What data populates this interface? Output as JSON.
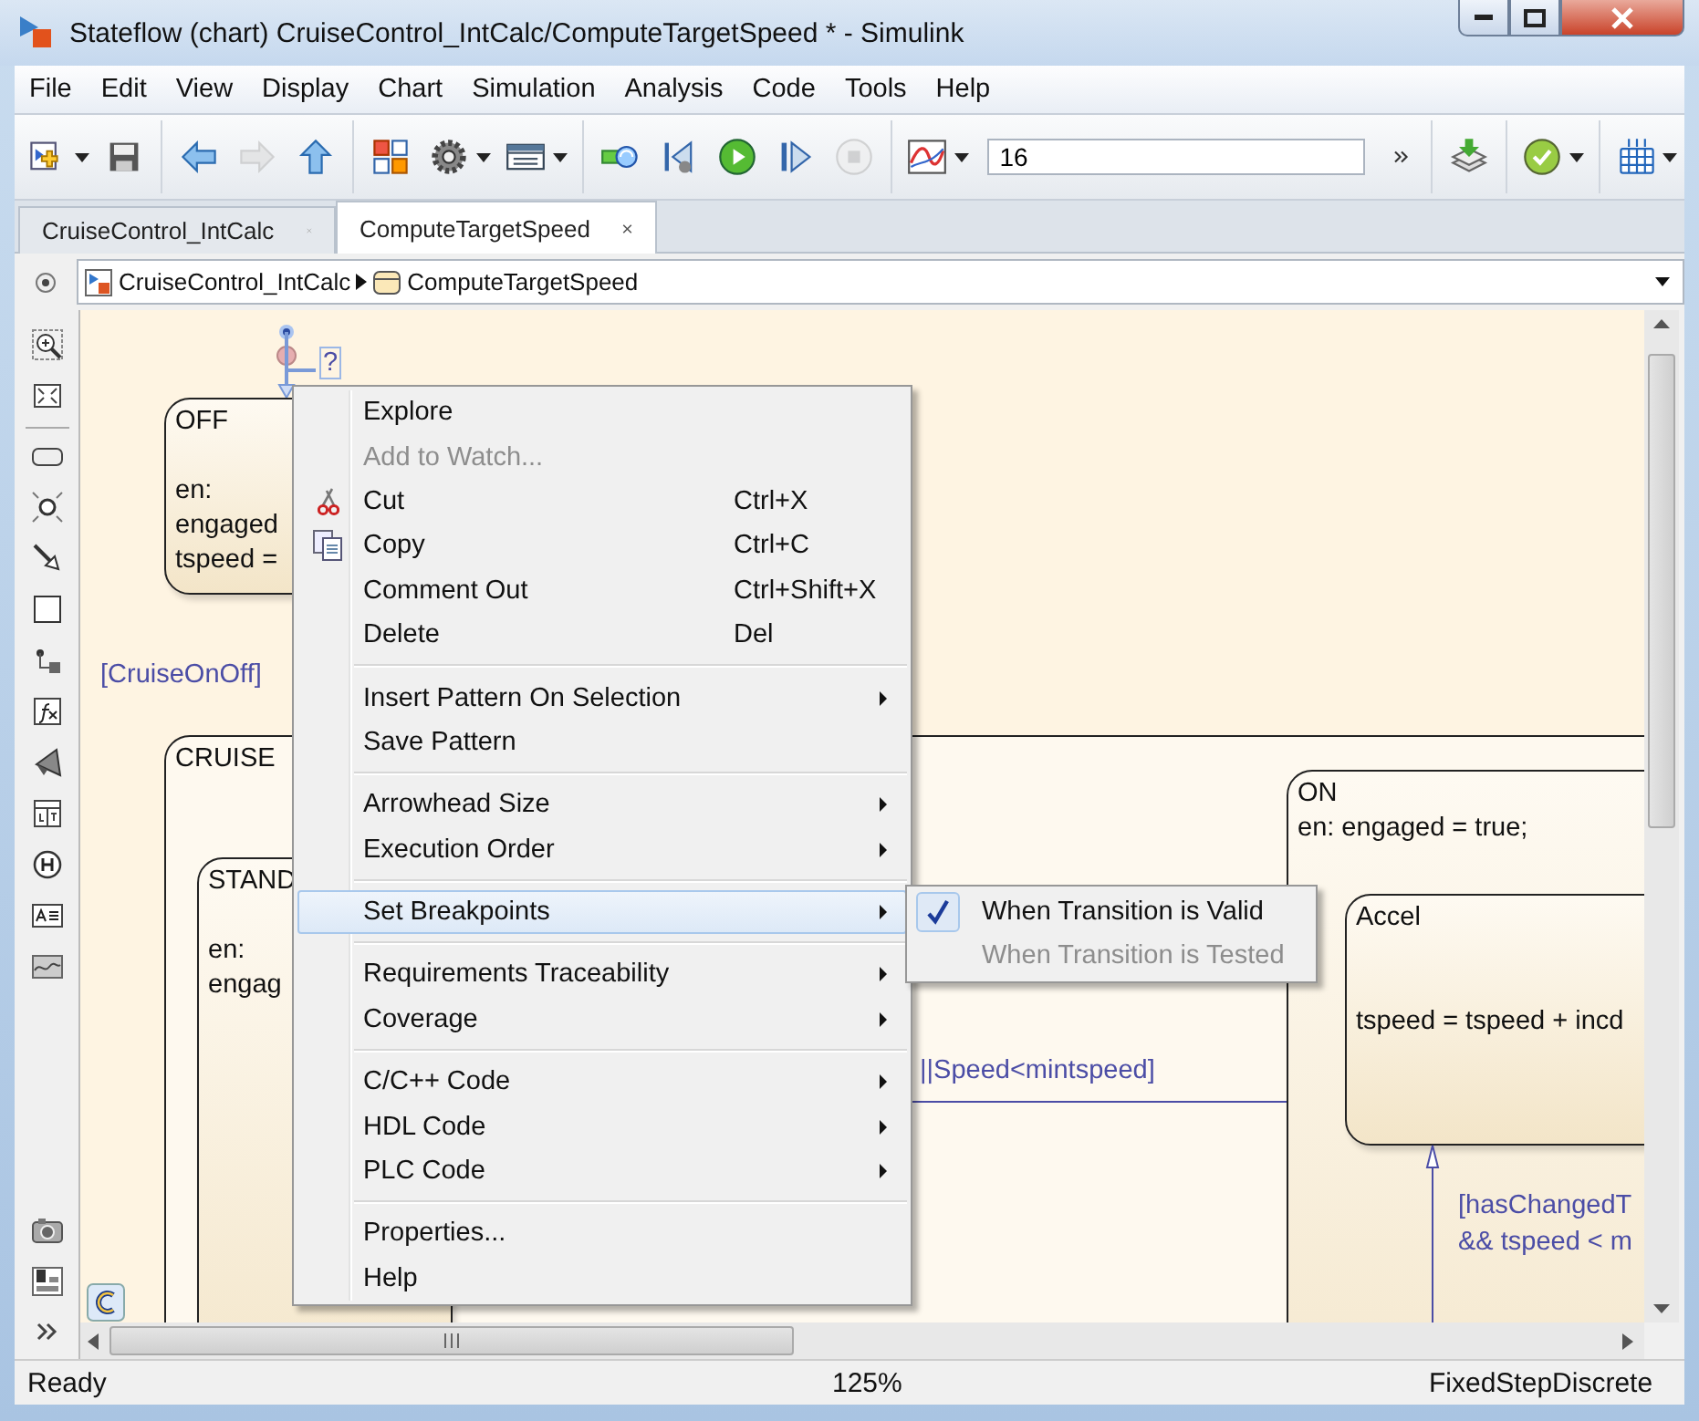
{
  "window": {
    "title": "Stateflow (chart) CruiseControl_IntCalc/ComputeTargetSpeed * - Simulink"
  },
  "menu_bar": [
    "File",
    "Edit",
    "View",
    "Display",
    "Chart",
    "Simulation",
    "Analysis",
    "Code",
    "Tools",
    "Help"
  ],
  "toolbar": {
    "buttons": [
      {
        "kind": "new-model",
        "disabled": false
      },
      {
        "kind": "save",
        "disabled": false
      },
      {
        "kind": "back",
        "disabled": false
      },
      {
        "kind": "forward",
        "disabled": true
      },
      {
        "kind": "up",
        "disabled": false
      },
      {
        "kind": "library",
        "disabled": false
      },
      {
        "kind": "gear",
        "disabled": false
      },
      {
        "kind": "config",
        "disabled": false
      },
      {
        "kind": "record",
        "disabled": false
      },
      {
        "kind": "step-back",
        "disabled": false
      },
      {
        "kind": "run",
        "disabled": false
      },
      {
        "kind": "step-forward",
        "disabled": false
      },
      {
        "kind": "stop",
        "disabled": true
      },
      {
        "kind": "scope",
        "disabled": false
      }
    ],
    "stop_time": "16",
    "right_buttons": [
      {
        "kind": "more",
        "disabled": false
      },
      {
        "kind": "layers",
        "disabled": false
      },
      {
        "kind": "check",
        "disabled": false
      },
      {
        "kind": "grid",
        "disabled": false
      }
    ]
  },
  "tabs": [
    {
      "label": "CruiseControl_IntCalc",
      "selected": false
    },
    {
      "label": "ComputeTargetSpeed",
      "selected": true
    }
  ],
  "breadcrumb": [
    {
      "kind": "model",
      "label": "CruiseControl_IntCalc"
    },
    {
      "kind": "chart",
      "label": "ComputeTargetSpeed"
    }
  ],
  "chart": {
    "states": [
      {
        "name": "OFF",
        "actions": [
          "en:",
          "engaged",
          "tspeed ="
        ]
      },
      {
        "name": "CRUISE"
      },
      {
        "name": "STAND",
        "actions": [
          "en:",
          "engag"
        ]
      },
      {
        "name": "ON",
        "actions": [
          "en: engaged = true;"
        ]
      },
      {
        "name": "Accel",
        "actions": [
          "tspeed = tspeed + incd"
        ]
      }
    ],
    "transition_labels": [
      [
        "[CruiseOnOff]"
      ],
      [
        "||Speed<mintspeed]"
      ],
      [
        "[hasChangedT",
        "&& tspeed < m"
      ]
    ],
    "pending_label": "?"
  },
  "context_menu": [
    [
      {
        "label": "Explore",
        "disabled": false,
        "selected": false,
        "submenu": false
      },
      {
        "label": "Add to Watch...",
        "disabled": true,
        "selected": false,
        "submenu": false
      },
      {
        "label": "Cut",
        "shortcut": "Ctrl+X",
        "disabled": false,
        "selected": false,
        "submenu": false
      },
      {
        "label": "Copy",
        "shortcut": "Ctrl+C",
        "disabled": false,
        "selected": false,
        "submenu": false
      },
      {
        "label": "Comment Out",
        "shortcut": "Ctrl+Shift+X",
        "disabled": false,
        "selected": false,
        "submenu": false
      },
      {
        "label": "Delete",
        "shortcut": "Del",
        "disabled": false,
        "selected": false,
        "submenu": false
      }
    ],
    [
      {
        "label": "Insert Pattern On Selection",
        "disabled": false,
        "selected": false,
        "submenu": true
      },
      {
        "label": "Save Pattern",
        "disabled": false,
        "selected": false,
        "submenu": false
      }
    ],
    [
      {
        "label": "Arrowhead Size",
        "disabled": false,
        "selected": false,
        "submenu": true
      },
      {
        "label": "Execution Order",
        "disabled": false,
        "selected": false,
        "submenu": true
      }
    ],
    [
      {
        "label": "Set Breakpoints",
        "disabled": false,
        "selected": true,
        "submenu": true
      }
    ],
    [
      {
        "label": "Requirements Traceability",
        "disabled": false,
        "selected": false,
        "submenu": true
      },
      {
        "label": "Coverage",
        "disabled": false,
        "selected": false,
        "submenu": true
      }
    ],
    [
      {
        "label": "C/C++ Code",
        "disabled": false,
        "selected": false,
        "submenu": true
      },
      {
        "label": "HDL Code",
        "disabled": false,
        "selected": false,
        "submenu": true
      },
      {
        "label": "PLC Code",
        "disabled": false,
        "selected": false,
        "submenu": true
      }
    ],
    [
      {
        "label": "Properties...",
        "disabled": false,
        "selected": false,
        "submenu": false
      },
      {
        "label": "Help",
        "disabled": false,
        "selected": false,
        "submenu": false
      }
    ]
  ],
  "submenu": [
    {
      "label": "When Transition is Valid",
      "checked": true,
      "disabled": false
    },
    {
      "label": "When Transition is Tested",
      "checked": false,
      "disabled": true
    }
  ],
  "status_bar": {
    "status": "Ready",
    "zoom": "125%",
    "solver": "FixedStepDiscrete"
  }
}
